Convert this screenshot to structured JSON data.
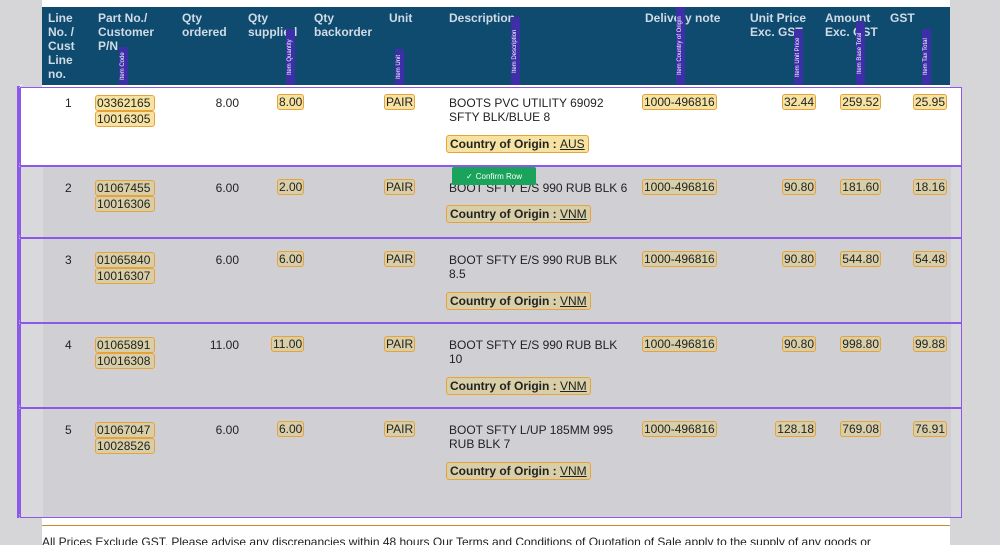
{
  "header": {
    "line": "Line No. / Cust Line no.",
    "part": "Part No./ Customer P/N",
    "qty_ordered": "Qty ordered",
    "qty_supplied": "Qty supplied",
    "qty_backorder": "Qty backorder",
    "unit": "Unit",
    "description": "Description",
    "delivery_note": "Delivery note",
    "unit_price": "Unit Price Exc. GST",
    "amount": "Amount Exc. GST",
    "gst": "GST"
  },
  "tags": {
    "item_code": "Item Code",
    "item_quantity": "Item Quantity",
    "item_unit": "Item Unit",
    "item_description": "Item Description",
    "item_country": "Item Country of Origin",
    "item_unit_price": "Item Unit Price",
    "item_base_total": "Item Base Total",
    "item_tax_total": "Item Tax Total"
  },
  "coo_label": "Country of Origin :",
  "confirm_label": "Confirm Row",
  "rows": [
    {
      "line": "1",
      "part1": "03362165",
      "part2": "10016305",
      "qty_ordered": "8.00",
      "qty_supplied": "8.00",
      "unit": "PAIR",
      "desc1": "BOOTS PVC UTILITY 69092",
      "desc2": "SFTY BLK/BLUE 8",
      "country": "AUS",
      "delivery": "1000-496816",
      "unit_price": "32.44",
      "amount": "259.52",
      "gst": "25.95"
    },
    {
      "line": "2",
      "part1": "01067455",
      "part2": "10016306",
      "qty_ordered": "6.00",
      "qty_supplied": "2.00",
      "unit": "PAIR",
      "desc1": "BOOT SFTY E/S 990 RUB BLK 6",
      "desc2": "",
      "country": "VNM",
      "delivery": "1000-496816",
      "unit_price": "90.80",
      "amount": "181.60",
      "gst": "18.16"
    },
    {
      "line": "3",
      "part1": "01065840",
      "part2": "10016307",
      "qty_ordered": "6.00",
      "qty_supplied": "6.00",
      "unit": "PAIR",
      "desc1": "BOOT SFTY E/S 990 RUB BLK",
      "desc2": "8.5",
      "country": "VNM",
      "delivery": "1000-496816",
      "unit_price": "90.80",
      "amount": "544.80",
      "gst": "54.48"
    },
    {
      "line": "4",
      "part1": "01065891",
      "part2": "10016308",
      "qty_ordered": "11.00",
      "qty_supplied": "11.00",
      "unit": "PAIR",
      "desc1": "BOOT SFTY E/S 990 RUB BLK",
      "desc2": "10",
      "country": "VNM",
      "delivery": "1000-496816",
      "unit_price": "90.80",
      "amount": "998.80",
      "gst": "99.88"
    },
    {
      "line": "5",
      "part1": "01067047",
      "part2": "10028526",
      "qty_ordered": "6.00",
      "qty_supplied": "6.00",
      "unit": "PAIR",
      "desc1": "BOOT SFTY L/UP 185MM 995",
      "desc2": "RUB BLK 7",
      "country": "VNM",
      "delivery": "1000-496816",
      "unit_price": "128.18",
      "amount": "769.08",
      "gst": "76.91"
    }
  ],
  "footer": "All Prices Exclude GST. Please advise any discrepancies within 48 hours Our Terms and Conditions of Quotation of Sale apply to the supply of any goods or"
}
